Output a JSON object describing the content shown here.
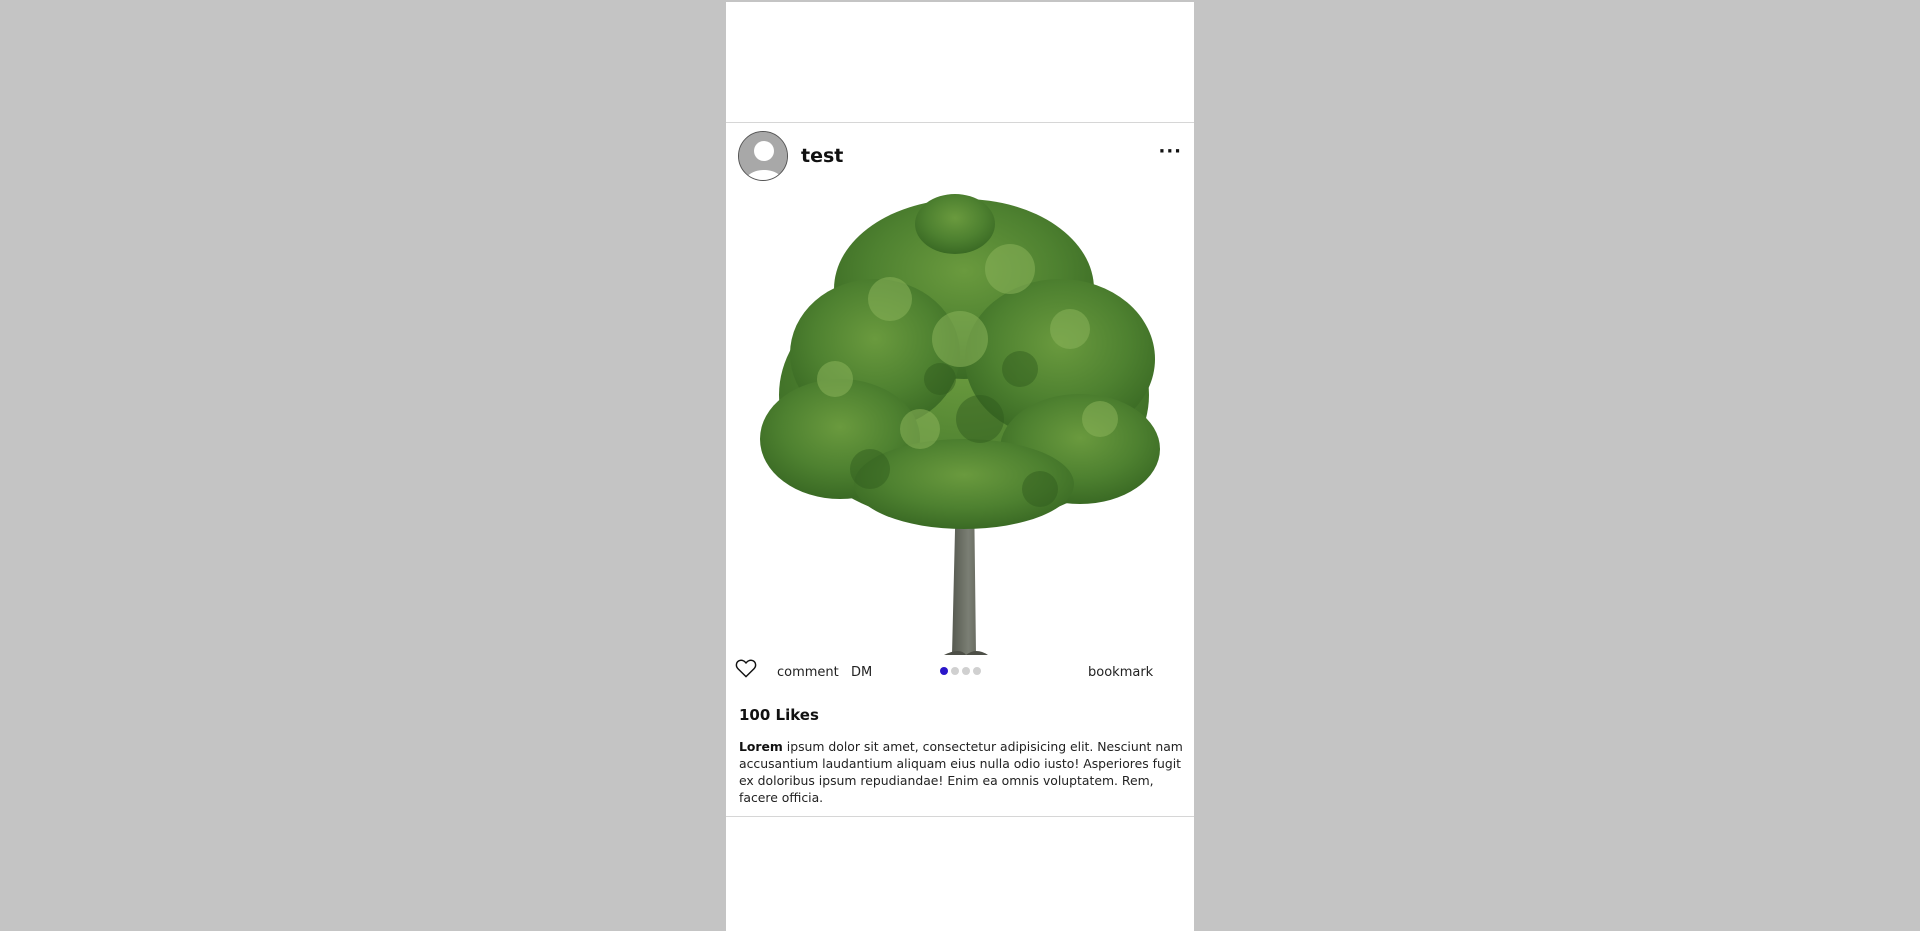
{
  "post": {
    "username": "test",
    "more_label": "···",
    "likes": "100 Likes",
    "caption_author": "Lorem",
    "caption_text": " ipsum dolor sit amet, consectetur adipisicing elit. Nesciunt nam accusantium laudantium aliquam eius nulla odio iusto! Asperiores fugit ex doloribus ipsum repudiandae! Enim ea omnis voluptatem. Rem, facere officia."
  },
  "actions": {
    "like_icon": "heart-icon",
    "comment_label": "comment",
    "dm_label": "DM",
    "bookmark_label": "bookmark"
  },
  "carousel": {
    "total": 4,
    "active_index": 0,
    "active_color": "#2a16c9"
  },
  "colors": {
    "background": "#c4c4c4",
    "card": "#ffffff"
  }
}
